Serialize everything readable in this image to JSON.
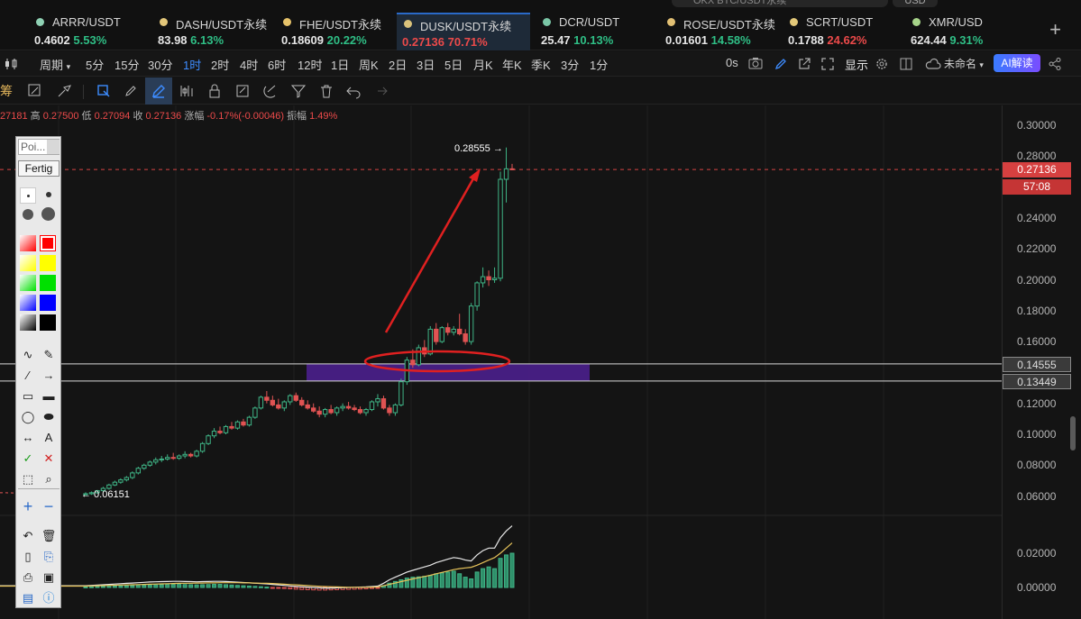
{
  "top": {
    "search_placeholder": "OKX BTC/USDT永续",
    "currency": "USD"
  },
  "tickers": [
    {
      "symbol": "ARRR/USDT",
      "price": "0.4602",
      "change": "5.53%",
      "dir": "up",
      "dot": "#8fd1b4"
    },
    {
      "symbol": "DASH/USDT永续",
      "price": "83.98",
      "change": "6.13%",
      "dir": "up",
      "dot": "#e3c77a"
    },
    {
      "symbol": "FHE/USDT永续",
      "price": "0.18609",
      "change": "20.22%",
      "dir": "up",
      "dot": "#e6c26a"
    },
    {
      "symbol": "DUSK/USDT永续",
      "price": "0.27136",
      "change": "70.71%",
      "dir": "down",
      "dot": "#d9c27b"
    },
    {
      "symbol": "DCR/USDT",
      "price": "25.47",
      "change": "10.13%",
      "dir": "up",
      "dot": "#7ac6a6"
    },
    {
      "symbol": "ROSE/USDT永续",
      "price": "0.01601",
      "change": "14.58%",
      "dir": "up",
      "dot": "#e2c074"
    },
    {
      "symbol": "SCRT/USDT",
      "price": "0.1788",
      "change": "24.62%",
      "dir": "down",
      "dot": "#e3c879"
    },
    {
      "symbol": "XMR/USD",
      "price": "624.44",
      "change": "9.31%",
      "dir": "up",
      "dot": "#a7d48a"
    }
  ],
  "intervals": {
    "period_label": "周期",
    "items": [
      "5分",
      "15分",
      "30分",
      "1时",
      "2时",
      "4时",
      "6时",
      "12时",
      "1日",
      "周K",
      "2日",
      "3日",
      "5日",
      "月K",
      "年K",
      "季K",
      "3分",
      "1分"
    ],
    "selected": "1时",
    "right": {
      "seconds": "0s",
      "display": "显示",
      "layout_name": "未命名",
      "ai": "AI解读"
    }
  },
  "tool_row_label": "筹",
  "ohlc": {
    "open_prefix": "",
    "open": "27181",
    "high_label": "高",
    "high": "0.27500",
    "low_label": "低",
    "low": "0.27094",
    "close_label": "收",
    "close": "0.27136",
    "change_label": "涨幅",
    "change": "-0.17%(-0.00046)",
    "amp_label": "振幅",
    "amp": "1.49%"
  },
  "palette": {
    "search": "Poi...",
    "done": "Fertig",
    "colors": [
      "#ff0000",
      "#ffff00",
      "#00e000",
      "#0000ff",
      "#000000"
    ]
  },
  "price_axis": {
    "labels": [
      "0.30000",
      "0.28000",
      "0.24000",
      "0.22000",
      "0.20000",
      "0.18000",
      "0.16000",
      "0.12000",
      "0.10000",
      "0.08000",
      "0.06000",
      "0.02000",
      "0.00000"
    ],
    "last_price": "0.27136",
    "countdown": "57:08",
    "zone_upper": "0.14555",
    "zone_lower": "0.13449"
  },
  "annotations": {
    "high_marker": "0.28555",
    "low_marker": "0.06151"
  },
  "chart_data": {
    "type": "candlestick",
    "title": "",
    "xlabel": "",
    "ylabel": "",
    "ylim": [
      0.04,
      0.31
    ],
    "last_price": 0.27136,
    "zone": [
      0.13449,
      0.14555
    ],
    "candles": [
      [
        0.0612,
        0.0625,
        0.0605,
        0.0615
      ],
      [
        0.0615,
        0.063,
        0.0608,
        0.0622
      ],
      [
        0.0622,
        0.064,
        0.0615,
        0.0635
      ],
      [
        0.0635,
        0.066,
        0.0628,
        0.065
      ],
      [
        0.065,
        0.068,
        0.0642,
        0.0672
      ],
      [
        0.0672,
        0.07,
        0.0665,
        0.069
      ],
      [
        0.069,
        0.0715,
        0.068,
        0.0705
      ],
      [
        0.0705,
        0.073,
        0.0695,
        0.072
      ],
      [
        0.072,
        0.076,
        0.071,
        0.075
      ],
      [
        0.075,
        0.079,
        0.074,
        0.078
      ],
      [
        0.078,
        0.081,
        0.077,
        0.08
      ],
      [
        0.08,
        0.083,
        0.079,
        0.082
      ],
      [
        0.082,
        0.085,
        0.0805,
        0.0835
      ],
      [
        0.0835,
        0.086,
        0.082,
        0.084
      ],
      [
        0.084,
        0.087,
        0.083,
        0.085
      ],
      [
        0.085,
        0.088,
        0.0835,
        0.0845
      ],
      [
        0.0845,
        0.087,
        0.0835,
        0.086
      ],
      [
        0.086,
        0.089,
        0.0845,
        0.087
      ],
      [
        0.087,
        0.088,
        0.085,
        0.086
      ],
      [
        0.086,
        0.09,
        0.085,
        0.089
      ],
      [
        0.089,
        0.095,
        0.088,
        0.094
      ],
      [
        0.094,
        0.1,
        0.093,
        0.099
      ],
      [
        0.099,
        0.104,
        0.0975,
        0.102
      ],
      [
        0.102,
        0.105,
        0.1,
        0.101
      ],
      [
        0.101,
        0.106,
        0.1,
        0.105
      ],
      [
        0.105,
        0.108,
        0.103,
        0.104
      ],
      [
        0.104,
        0.109,
        0.103,
        0.108
      ],
      [
        0.108,
        0.11,
        0.105,
        0.106
      ],
      [
        0.106,
        0.112,
        0.105,
        0.111
      ],
      [
        0.111,
        0.118,
        0.11,
        0.117
      ],
      [
        0.117,
        0.125,
        0.116,
        0.124
      ],
      [
        0.124,
        0.128,
        0.12,
        0.122
      ],
      [
        0.122,
        0.125,
        0.118,
        0.119
      ],
      [
        0.119,
        0.123,
        0.116,
        0.117
      ],
      [
        0.117,
        0.122,
        0.115,
        0.121
      ],
      [
        0.121,
        0.126,
        0.119,
        0.125
      ],
      [
        0.125,
        0.127,
        0.121,
        0.122
      ],
      [
        0.122,
        0.124,
        0.118,
        0.119
      ],
      [
        0.119,
        0.122,
        0.116,
        0.117
      ],
      [
        0.117,
        0.12,
        0.114,
        0.115
      ],
      [
        0.115,
        0.118,
        0.111,
        0.113
      ],
      [
        0.113,
        0.117,
        0.111,
        0.116
      ],
      [
        0.116,
        0.119,
        0.113,
        0.114
      ],
      [
        0.114,
        0.118,
        0.112,
        0.117
      ],
      [
        0.117,
        0.12,
        0.115,
        0.118
      ],
      [
        0.118,
        0.121,
        0.116,
        0.117
      ],
      [
        0.117,
        0.119,
        0.115,
        0.116
      ],
      [
        0.116,
        0.118,
        0.113,
        0.114
      ],
      [
        0.114,
        0.117,
        0.112,
        0.116
      ],
      [
        0.116,
        0.122,
        0.115,
        0.121
      ],
      [
        0.121,
        0.126,
        0.118,
        0.123
      ],
      [
        0.123,
        0.125,
        0.116,
        0.117
      ],
      [
        0.117,
        0.119,
        0.112,
        0.114
      ],
      [
        0.114,
        0.12,
        0.112,
        0.119
      ],
      [
        0.119,
        0.136,
        0.118,
        0.134
      ],
      [
        0.134,
        0.15,
        0.132,
        0.148
      ],
      [
        0.148,
        0.155,
        0.143,
        0.145
      ],
      [
        0.145,
        0.158,
        0.144,
        0.156
      ],
      [
        0.156,
        0.161,
        0.15,
        0.152
      ],
      [
        0.152,
        0.17,
        0.151,
        0.168
      ],
      [
        0.168,
        0.172,
        0.158,
        0.16
      ],
      [
        0.16,
        0.17,
        0.159,
        0.169
      ],
      [
        0.169,
        0.172,
        0.164,
        0.166
      ],
      [
        0.166,
        0.17,
        0.164,
        0.168
      ],
      [
        0.168,
        0.178,
        0.164,
        0.165
      ],
      [
        0.165,
        0.168,
        0.158,
        0.16
      ],
      [
        0.16,
        0.185,
        0.158,
        0.183
      ],
      [
        0.183,
        0.199,
        0.18,
        0.198
      ],
      [
        0.198,
        0.208,
        0.195,
        0.202
      ],
      [
        0.202,
        0.206,
        0.196,
        0.2
      ],
      [
        0.2,
        0.208,
        0.198,
        0.201
      ],
      [
        0.201,
        0.27,
        0.199,
        0.265
      ],
      [
        0.265,
        0.2856,
        0.25,
        0.2718
      ],
      [
        0.2718,
        0.275,
        0.2709,
        0.2714
      ]
    ],
    "macd": {
      "hist": [
        0.0003,
        0.0004,
        0.0005,
        0.0006,
        0.0007,
        0.0008,
        0.0009,
        0.001,
        0.0011,
        0.0012,
        0.0013,
        0.0014,
        0.0015,
        0.0016,
        0.0017,
        0.0018,
        0.0018,
        0.0017,
        0.0016,
        0.0015,
        0.0016,
        0.0017,
        0.0018,
        0.0018,
        0.0016,
        0.0014,
        0.0012,
        0.001,
        0.0008,
        0.0006,
        0.0004,
        0.0002,
        -0.0002,
        -0.0004,
        -0.0006,
        -0.0008,
        -0.001,
        -0.0012,
        -0.0013,
        -0.0014,
        -0.0015,
        -0.0015,
        -0.0014,
        -0.0013,
        -0.0012,
        -0.0011,
        -0.001,
        -0.0009,
        -0.0008,
        -0.0006,
        -0.0004,
        0.001,
        0.0025,
        0.0035,
        0.0045,
        0.0055,
        0.006,
        0.0062,
        0.0065,
        0.007,
        0.008,
        0.0085,
        0.009,
        0.0095,
        0.008,
        0.006,
        0.005,
        0.009,
        0.011,
        0.012,
        0.011,
        0.017,
        0.019,
        0.02
      ],
      "macd_line": [
        0.001,
        0.0012,
        0.0014,
        0.0016,
        0.0018,
        0.002,
        0.0022,
        0.0024,
        0.0026,
        0.0028,
        0.003,
        0.0032,
        0.0033,
        0.0034,
        0.0035,
        0.0036,
        0.0036,
        0.0035,
        0.0034,
        0.0033,
        0.0034,
        0.0035,
        0.0036,
        0.0036,
        0.0035,
        0.0033,
        0.0031,
        0.0029,
        0.0027,
        0.0025,
        0.0023,
        0.0021,
        0.0018,
        0.0015,
        0.0012,
        0.0009,
        0.0006,
        0.0004,
        0.0002,
        0.0,
        -0.0002,
        -0.0003,
        -0.0003,
        -0.0002,
        -0.0001,
        0.0,
        0.0001,
        0.0002,
        0.0003,
        0.0005,
        0.0008,
        0.0025,
        0.0045,
        0.006,
        0.0075,
        0.009,
        0.01,
        0.011,
        0.012,
        0.013,
        0.0145,
        0.0155,
        0.0165,
        0.0175,
        0.017,
        0.016,
        0.0155,
        0.019,
        0.0215,
        0.023,
        0.023,
        0.029,
        0.033,
        0.036
      ],
      "signal_line": [
        0.0008,
        0.0009,
        0.001,
        0.0011,
        0.0012,
        0.0013,
        0.0014,
        0.0015,
        0.0016,
        0.0017,
        0.0018,
        0.0019,
        0.002,
        0.0021,
        0.0022,
        0.0023,
        0.0024,
        0.0025,
        0.0025,
        0.0026,
        0.0026,
        0.0027,
        0.0027,
        0.0028,
        0.0028,
        0.0028,
        0.0028,
        0.0027,
        0.0027,
        0.0026,
        0.0025,
        0.0024,
        0.0023,
        0.0021,
        0.0019,
        0.0017,
        0.0015,
        0.0013,
        0.0011,
        0.0009,
        0.0007,
        0.0005,
        0.0004,
        0.0003,
        0.0002,
        0.0001,
        0.0001,
        0.0001,
        0.0001,
        0.0002,
        0.0003,
        0.001,
        0.0018,
        0.0026,
        0.0034,
        0.0042,
        0.005,
        0.0057,
        0.0064,
        0.0071,
        0.008,
        0.0088,
        0.0096,
        0.0104,
        0.011,
        0.0114,
        0.0118,
        0.013,
        0.0145,
        0.016,
        0.0175,
        0.02,
        0.023,
        0.026
      ]
    }
  }
}
